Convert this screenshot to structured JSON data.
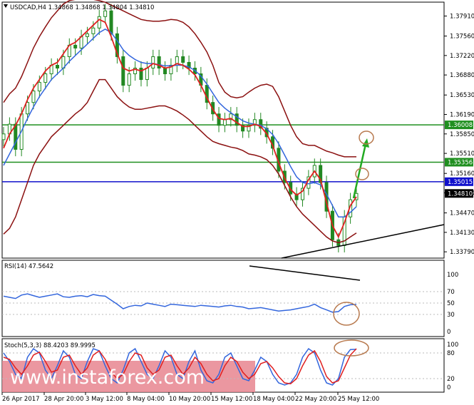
{
  "header": {
    "symbol_line": "USDCAD,H4 1.34868 1.34868 1.34804 1.34810",
    "rsi_label": "RSI(14) 47.5642",
    "stoch_label": "Stoch(5,3,3) 88.4203 89.9995"
  },
  "watermark": "www.instaforex.com",
  "colors": {
    "candle": "#228822",
    "ma_fast": "#e02020",
    "ma_slow": "#3366dd",
    "bands": "#8b1010",
    "level_green": "#1f8f1f",
    "level_blue": "#1010cc",
    "trend": "#000000",
    "arrow": "#22aa22",
    "circle": "#b87a4f",
    "stoch_main": "#3366dd",
    "stoch_signal": "#e02020",
    "watermark_bg": "#e8858f"
  },
  "chart_data": [
    {
      "type": "candlestick",
      "symbol": "USDCAD",
      "timeframe": "H4",
      "ohlc_last": [
        1.34868,
        1.34868,
        1.34804,
        1.3481
      ],
      "ylim": [
        1.3368,
        1.3814
      ],
      "y_ticks": [
        1.3791,
        1.3756,
        1.3722,
        1.3688,
        1.3653,
        1.3619,
        1.3585,
        1.3551,
        1.3516,
        1.3482,
        1.3447,
        1.3413,
        1.3379
      ],
      "y_tick_labels": [
        "1.37910",
        "1.37560",
        "1.37220",
        "1.36880",
        "1.36530",
        "1.36190",
        "1.35850",
        "1.35510",
        "1.35160",
        "1.34820",
        "1.34470",
        "1.34130",
        "1.33790"
      ],
      "x_tick_labels": [
        "26 Apr 2017",
        "28 Apr 20:00",
        "3 May 12:00",
        "8 May 04:00",
        "10 May 20:00",
        "15 May 12:00",
        "18 May 04:00",
        "22 May 20:00",
        "25 May 12:00"
      ],
      "close": [
        1.3585,
        1.3602,
        1.3558,
        1.362,
        1.364,
        1.366,
        1.3675,
        1.369,
        1.3705,
        1.37,
        1.372,
        1.374,
        1.3735,
        1.3755,
        1.376,
        1.377,
        1.379,
        1.38,
        1.376,
        1.372,
        1.367,
        1.369,
        1.37,
        1.368,
        1.37,
        1.372,
        1.37,
        1.369,
        1.3705,
        1.372,
        1.371,
        1.37,
        1.369,
        1.367,
        1.364,
        1.362,
        1.36,
        1.361,
        1.362,
        1.36,
        1.359,
        1.36,
        1.361,
        1.3595,
        1.358,
        1.356,
        1.352,
        1.35,
        1.348,
        1.347,
        1.349,
        1.351,
        1.353,
        1.35,
        1.345,
        1.34,
        1.339,
        1.344,
        1.347,
        1.3481
      ],
      "ma_fast": [
        1.356,
        1.3585,
        1.36,
        1.362,
        1.3645,
        1.3665,
        1.368,
        1.3695,
        1.3705,
        1.371,
        1.3725,
        1.374,
        1.3745,
        1.3755,
        1.3765,
        1.3775,
        1.3785,
        1.378,
        1.3755,
        1.3725,
        1.37,
        1.3695,
        1.3698,
        1.3695,
        1.37,
        1.3708,
        1.3705,
        1.37,
        1.3702,
        1.3708,
        1.3705,
        1.3698,
        1.3688,
        1.367,
        1.3648,
        1.3628,
        1.3612,
        1.361,
        1.3612,
        1.3605,
        1.3598,
        1.3598,
        1.3602,
        1.3598,
        1.3585,
        1.3565,
        1.3535,
        1.3508,
        1.3488,
        1.3478,
        1.3485,
        1.3505,
        1.352,
        1.3505,
        1.3465,
        1.3425,
        1.3405,
        1.343,
        1.346,
        1.3475
      ],
      "ma_slow": [
        1.353,
        1.355,
        1.357,
        1.359,
        1.3612,
        1.3632,
        1.365,
        1.3665,
        1.368,
        1.369,
        1.37,
        1.3712,
        1.3722,
        1.3732,
        1.3742,
        1.3752,
        1.3762,
        1.3768,
        1.3762,
        1.3748,
        1.3732,
        1.3722,
        1.3715,
        1.371,
        1.3708,
        1.3708,
        1.3706,
        1.3704,
        1.3704,
        1.3705,
        1.3705,
        1.3702,
        1.3696,
        1.3686,
        1.3672,
        1.3656,
        1.364,
        1.363,
        1.3622,
        1.3615,
        1.3608,
        1.3604,
        1.3602,
        1.36,
        1.3594,
        1.3584,
        1.3568,
        1.3548,
        1.3528,
        1.351,
        1.35,
        1.3498,
        1.35,
        1.3496,
        1.348,
        1.346,
        1.344,
        1.344,
        1.3448,
        1.3458
      ],
      "upper_band": [
        1.364,
        1.3655,
        1.3665,
        1.3685,
        1.371,
        1.3735,
        1.3755,
        1.3772,
        1.3788,
        1.38,
        1.3812,
        1.3818,
        1.382,
        1.3822,
        1.3822,
        1.382,
        1.3818,
        1.3815,
        1.381,
        1.3805,
        1.38,
        1.3795,
        1.379,
        1.3785,
        1.3783,
        1.3782,
        1.3782,
        1.3783,
        1.3785,
        1.3784,
        1.378,
        1.3772,
        1.376,
        1.3745,
        1.3728,
        1.3705,
        1.3675,
        1.3658,
        1.365,
        1.3648,
        1.365,
        1.3658,
        1.3665,
        1.367,
        1.3672,
        1.3668,
        1.365,
        1.3625,
        1.36,
        1.358,
        1.3568,
        1.3565,
        1.3565,
        1.356,
        1.3555,
        1.3552,
        1.3548,
        1.3545,
        1.3545,
        1.3545
      ],
      "lower_band": [
        1.341,
        1.342,
        1.344,
        1.347,
        1.35,
        1.353,
        1.355,
        1.3565,
        1.358,
        1.359,
        1.36,
        1.361,
        1.362,
        1.3628,
        1.364,
        1.366,
        1.368,
        1.368,
        1.3665,
        1.365,
        1.364,
        1.3632,
        1.3628,
        1.3628,
        1.363,
        1.3632,
        1.3634,
        1.3634,
        1.363,
        1.3625,
        1.3618,
        1.361,
        1.36,
        1.359,
        1.358,
        1.3572,
        1.3568,
        1.3565,
        1.3562,
        1.356,
        1.3556,
        1.355,
        1.3548,
        1.3545,
        1.354,
        1.353,
        1.3515,
        1.3495,
        1.3475,
        1.3458,
        1.3445,
        1.3435,
        1.3425,
        1.3415,
        1.3405,
        1.3398,
        1.3395,
        1.3398,
        1.3405,
        1.3412
      ],
      "levels": [
        {
          "value": 1.36008,
          "label": "1.36008",
          "color": "#1f8f1f"
        },
        {
          "value": 1.35356,
          "label": "1.35356",
          "color": "#1f8f1f"
        },
        {
          "value": 1.35015,
          "label": "1.35015",
          "color": "#1010cc"
        },
        {
          "value": 1.3481,
          "label": "1.34810",
          "color": "#000000"
        }
      ]
    },
    {
      "type": "line",
      "indicator": "RSI(14)",
      "last_value": 47.5642,
      "ylim": [
        0,
        100
      ],
      "y_tick_labels": [
        "100",
        "70",
        "50",
        "30",
        "0"
      ],
      "values": [
        62,
        60,
        58,
        64,
        66,
        63,
        60,
        62,
        64,
        66,
        61,
        60,
        62,
        63,
        61,
        65,
        63,
        62,
        55,
        48,
        40,
        44,
        46,
        45,
        50,
        48,
        46,
        44,
        48,
        47,
        46,
        45,
        44,
        46,
        45,
        44,
        43,
        45,
        46,
        44,
        43,
        40,
        41,
        42,
        40,
        38,
        36,
        37,
        38,
        40,
        42,
        44,
        48,
        42,
        38,
        34,
        35,
        44,
        47,
        47.56
      ]
    },
    {
      "type": "line",
      "indicator": "Stoch(5,3,3)",
      "main_last": 88.4203,
      "signal_last": 89.9995,
      "ylim": [
        0,
        100
      ],
      "y_tick_labels": [
        "100",
        "80",
        "20",
        "0"
      ],
      "main": [
        80,
        60,
        30,
        20,
        70,
        90,
        80,
        40,
        20,
        50,
        85,
        70,
        30,
        20,
        60,
        90,
        85,
        50,
        20,
        10,
        40,
        80,
        90,
        60,
        30,
        20,
        50,
        85,
        70,
        30,
        20,
        60,
        85,
        40,
        15,
        10,
        30,
        70,
        80,
        50,
        20,
        15,
        40,
        70,
        60,
        30,
        10,
        5,
        10,
        30,
        70,
        90,
        80,
        40,
        10,
        5,
        20,
        70,
        88,
        88.42
      ],
      "signal": [
        70,
        65,
        45,
        30,
        50,
        75,
        82,
        60,
        35,
        40,
        70,
        75,
        50,
        30,
        45,
        75,
        85,
        65,
        35,
        20,
        30,
        60,
        80,
        75,
        45,
        30,
        40,
        70,
        75,
        50,
        30,
        45,
        70,
        55,
        30,
        15,
        20,
        50,
        70,
        60,
        35,
        20,
        30,
        55,
        60,
        45,
        25,
        10,
        8,
        20,
        50,
        75,
        85,
        60,
        25,
        10,
        15,
        45,
        75,
        90.0
      ]
    }
  ]
}
